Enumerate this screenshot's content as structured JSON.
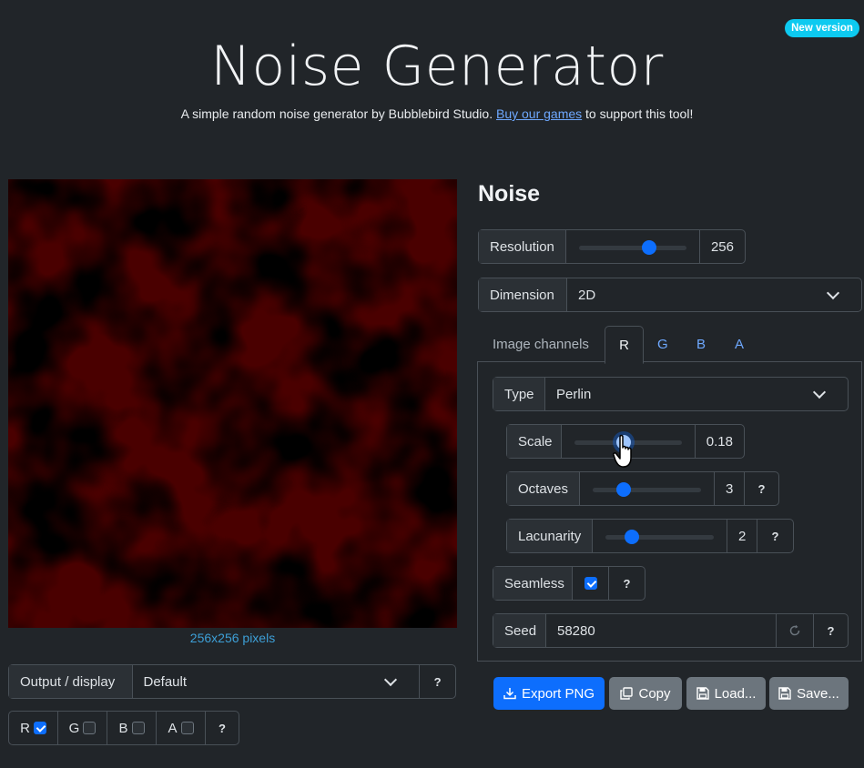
{
  "badge": "New version",
  "header": {
    "title": "Noise Generator",
    "subtitle_pre": "A simple random noise generator by Bubblebird Studio. ",
    "subtitle_link": "Buy our games",
    "subtitle_post": " to support this tool!"
  },
  "preview": {
    "caption": "256x256 pixels"
  },
  "output": {
    "label": "Output / display",
    "value": "Default",
    "help": "?",
    "channels": [
      {
        "label": "R",
        "checked": true
      },
      {
        "label": "G",
        "checked": false
      },
      {
        "label": "B",
        "checked": false
      },
      {
        "label": "A",
        "checked": false
      }
    ],
    "channels_help": "?"
  },
  "noise": {
    "title": "Noise",
    "resolution": {
      "label": "Resolution",
      "value": "256",
      "level": 0.68
    },
    "dimension": {
      "label": "Dimension",
      "value": "2D"
    },
    "tabs": {
      "label": "Image channels",
      "items": [
        "R",
        "G",
        "B",
        "A"
      ],
      "active": "R"
    },
    "type": {
      "label": "Type",
      "value": "Perlin"
    },
    "scale": {
      "label": "Scale",
      "value": "0.18",
      "level": 0.45
    },
    "octaves": {
      "label": "Octaves",
      "value": "3",
      "level": 0.25,
      "help": "?"
    },
    "lacunarity": {
      "label": "Lacunarity",
      "value": "2",
      "level": 0.2,
      "help": "?"
    },
    "seamless": {
      "label": "Seamless",
      "checked": true,
      "help": "?"
    },
    "seed": {
      "label": "Seed",
      "value": "58280",
      "help": "?"
    }
  },
  "actions": {
    "export": "Export PNG",
    "copy": "Copy",
    "load": "Load...",
    "save": "Save..."
  },
  "colors": {
    "primary": "#0d6efd",
    "secondary": "#6c757d",
    "info": "#0dcaf0",
    "noise": "#ff0000"
  }
}
